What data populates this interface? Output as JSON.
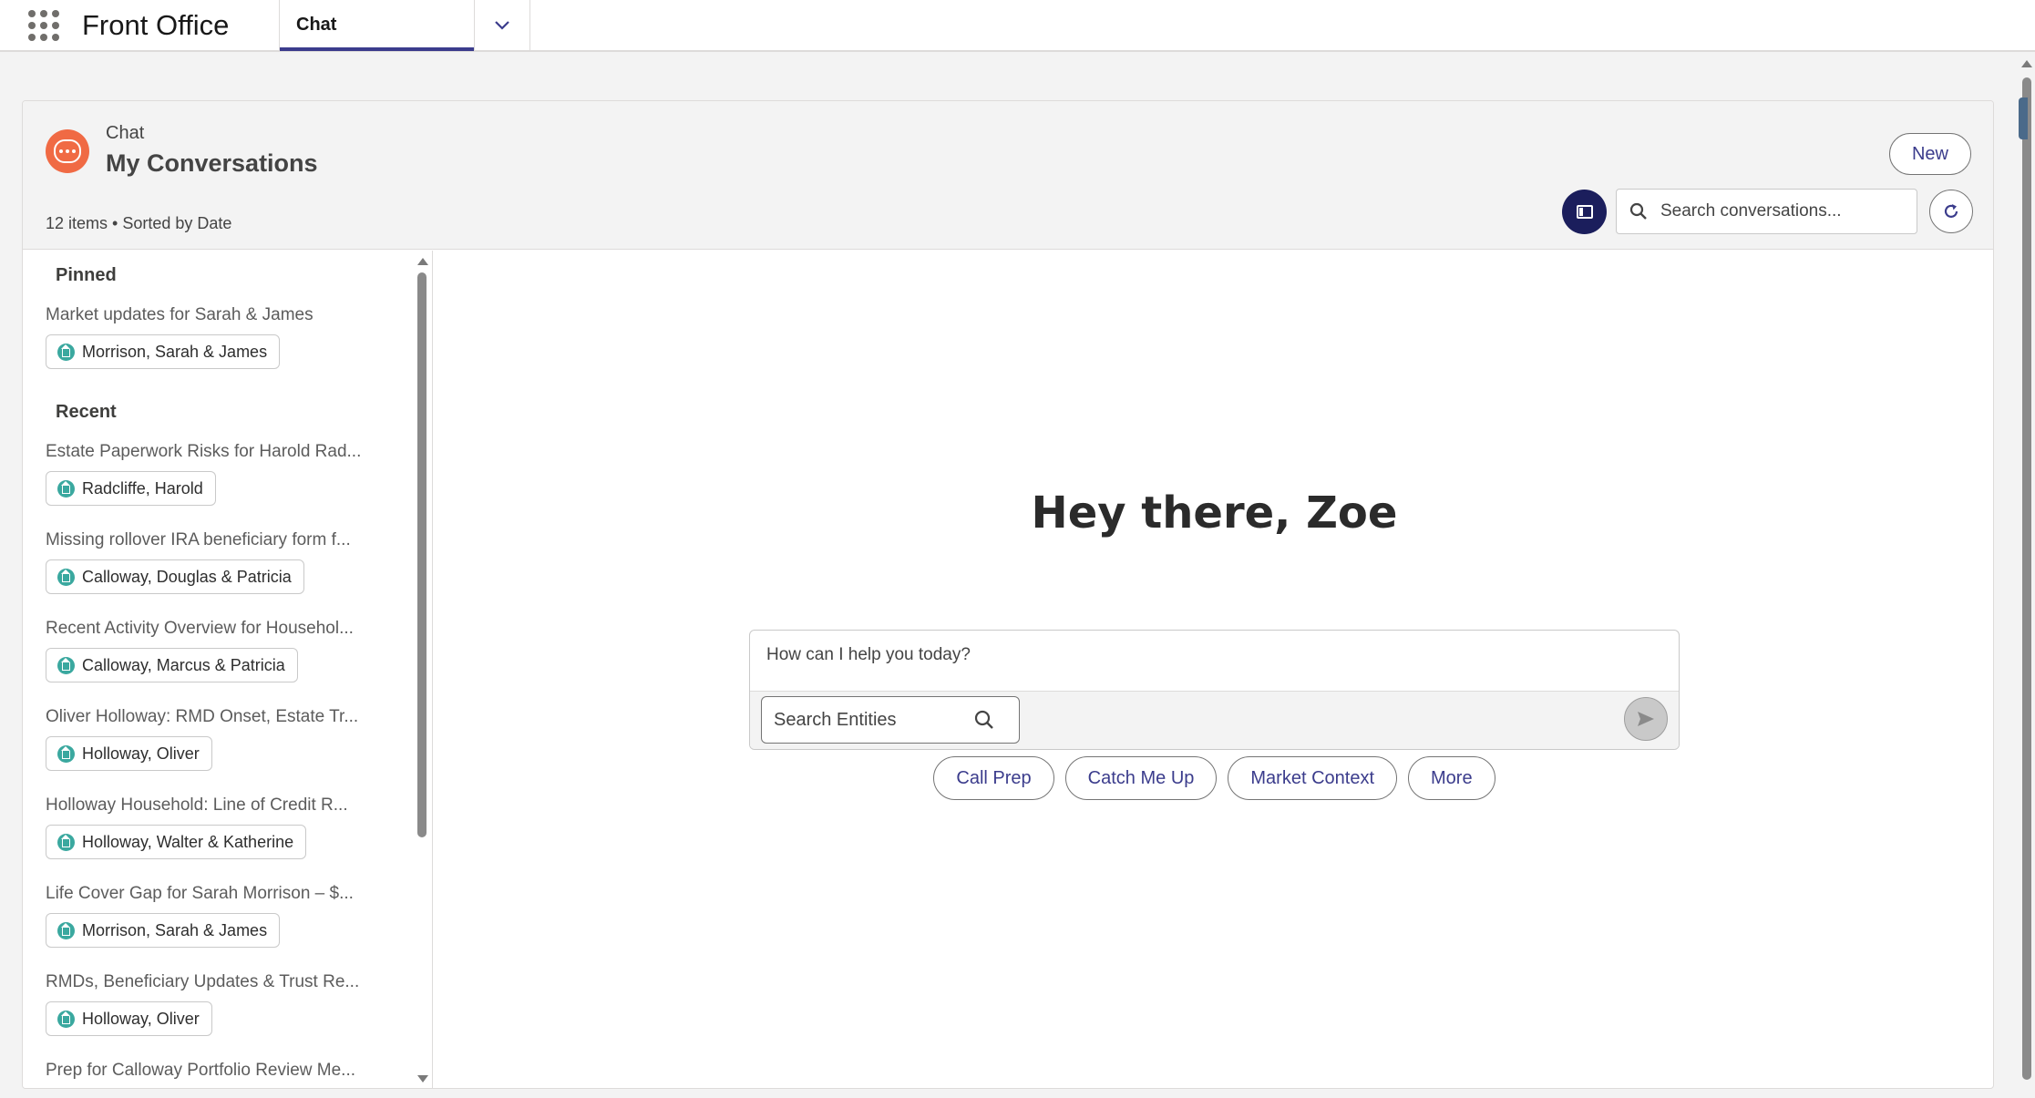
{
  "app": {
    "name": "Front Office",
    "active_tab": "Chat"
  },
  "header": {
    "eyebrow": "Chat",
    "title": "My Conversations",
    "meta": "12 items • Sorted by Date",
    "new_label": "New",
    "search_placeholder": "Search conversations..."
  },
  "sidebar": {
    "pinned_label": "Pinned",
    "recent_label": "Recent",
    "pinned": [
      {
        "title": "Market updates for Sarah & James",
        "chip": "Morrison, Sarah & James"
      }
    ],
    "recent": [
      {
        "title": "Estate Paperwork Risks for Harold Rad...",
        "chip": "Radcliffe, Harold"
      },
      {
        "title": "Missing rollover IRA beneficiary form f...",
        "chip": "Calloway, Douglas & Patricia"
      },
      {
        "title": "Recent Activity Overview for Househol...",
        "chip": "Calloway, Marcus & Patricia"
      },
      {
        "title": "Oliver Holloway: RMD Onset, Estate Tr...",
        "chip": "Holloway, Oliver"
      },
      {
        "title": "Holloway Household: Line of Credit R...",
        "chip": "Holloway, Walter & Katherine"
      },
      {
        "title": "Life Cover Gap for Sarah Morrison – $...",
        "chip": "Morrison, Sarah & James"
      },
      {
        "title": "RMDs, Beneficiary Updates & Trust Re...",
        "chip": "Holloway, Oliver"
      },
      {
        "title": "Prep for Calloway Portfolio Review Me...",
        "chip": ""
      }
    ]
  },
  "main": {
    "greeting": "Hey there, Zoe",
    "composer_placeholder": "How can I help you today?",
    "entity_search_placeholder": "Search Entities",
    "quick_actions": [
      "Call Prep",
      "Catch Me Up",
      "Market Context",
      "More"
    ]
  },
  "colors": {
    "brand_accent": "#3b3c8c",
    "chat_icon": "#f06a44",
    "panel_button": "#1b1e5c",
    "entity_chip_icon": "#3aa89f"
  }
}
